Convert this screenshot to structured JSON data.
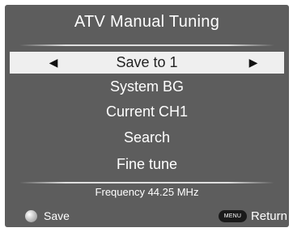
{
  "title": "ATV Manual Tuning",
  "menu": {
    "items": [
      {
        "label": "Save to 1",
        "selected": true
      },
      {
        "label": "System BG",
        "selected": false
      },
      {
        "label": "Current CH1",
        "selected": false
      },
      {
        "label": "Search",
        "selected": false
      },
      {
        "label": "Fine tune",
        "selected": false
      }
    ],
    "left_arrow": "◀",
    "right_arrow": "▶"
  },
  "frequency_text": "Frequency 44.25 MHz",
  "footer": {
    "save_label": "Save",
    "menu_button_label": "MENU",
    "return_label": "Return"
  },
  "colors": {
    "panel_bg": "#5d5d5d",
    "selected_row_bg": "#efefef",
    "text": "#ffffff",
    "selected_text": "#222222"
  }
}
